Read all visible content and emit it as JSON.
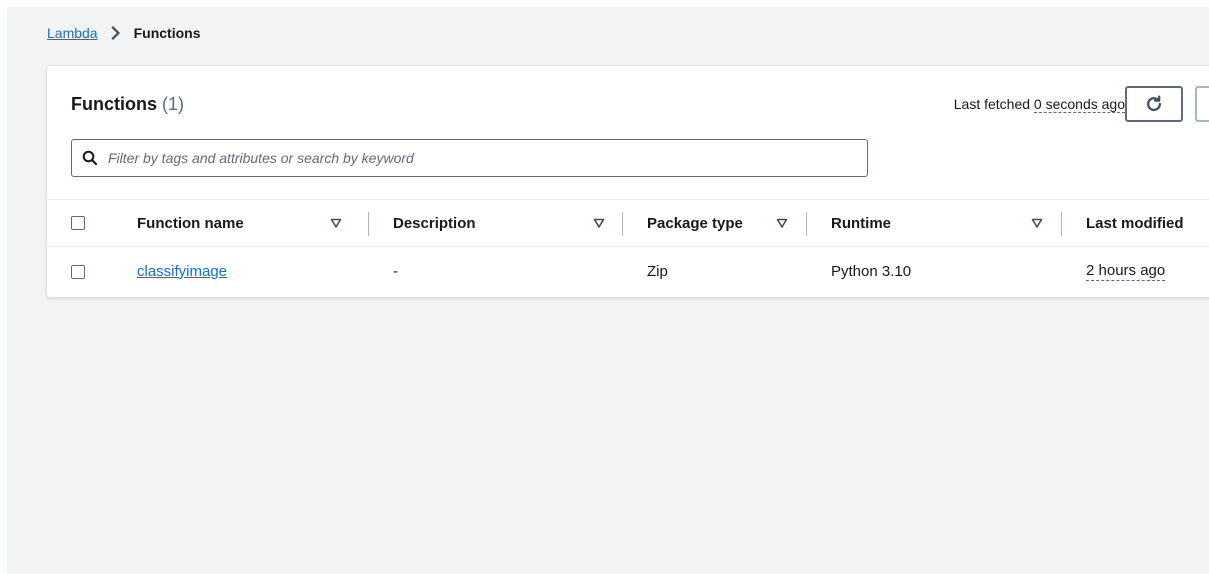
{
  "breadcrumb": {
    "root": "Lambda",
    "current": "Functions"
  },
  "header": {
    "title": "Functions",
    "count": "(1)",
    "last_fetched_prefix": "Last fetched",
    "last_fetched_value": "0 seconds ago"
  },
  "search": {
    "value": "",
    "placeholder": "Filter by tags and attributes or search by keyword"
  },
  "table": {
    "columns": [
      "Function name",
      "Description",
      "Package type",
      "Runtime",
      "Last modified"
    ],
    "rows": [
      {
        "name": "classifyimage",
        "description": "-",
        "package_type": "Zip",
        "runtime": "Python 3.10",
        "last_modified": "2 hours ago"
      }
    ]
  },
  "colors": {
    "link": "#0972d3",
    "page_background": "#f2f3f3",
    "text": "#16191f"
  }
}
